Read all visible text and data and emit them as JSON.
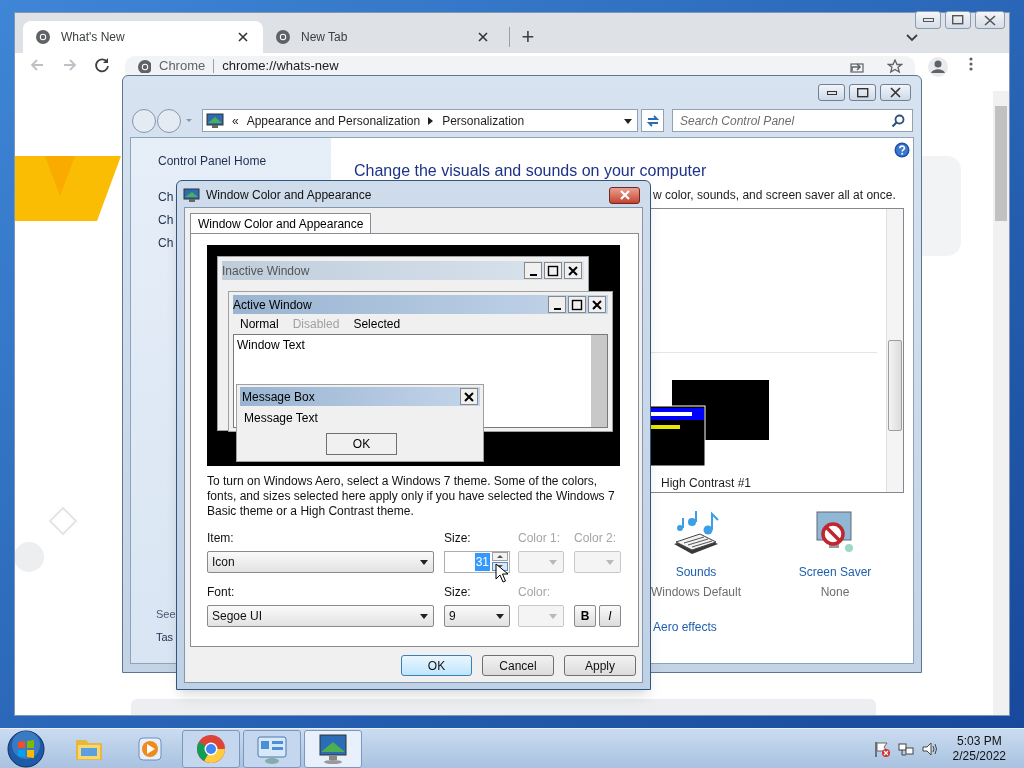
{
  "browser": {
    "tabs": [
      {
        "title": "What's New",
        "selected": true
      },
      {
        "title": "New Tab",
        "selected": false
      }
    ],
    "new_tab": "+",
    "address_bar": {
      "site": "Chrome",
      "url": "chrome://whats-new"
    }
  },
  "control_panel": {
    "breadcrumb_prefix": "«",
    "breadcrumb": [
      "Appearance and Personalization",
      "Personalization"
    ],
    "search": {
      "placeholder": "Search Control Panel"
    },
    "sidebar": {
      "items": [
        "Control Panel Home",
        "Ch",
        "Ch",
        "Ch"
      ],
      "see_also": [
        "See",
        "Tas"
      ]
    },
    "heading": "Change the visuals and sounds on your computer",
    "description": "w color, sounds, and screen saver all at once.",
    "themes": [
      {
        "name": "High Contrast #1"
      }
    ],
    "settings": [
      {
        "kind": "sounds",
        "label": "Sounds",
        "value": "Windows Default"
      },
      {
        "kind": "screen_saver",
        "label": "Screen Saver",
        "value": "None"
      }
    ],
    "link": "Aero effects"
  },
  "dialog": {
    "title": "Window Color and Appearance",
    "tabs": [
      {
        "label": "Window Color and Appearance",
        "selected": true
      }
    ],
    "preview": {
      "inactive_title": "Inactive Window",
      "active_title": "Active Window",
      "menu": [
        {
          "label": "Normal",
          "disabled": false
        },
        {
          "label": "Disabled",
          "disabled": true
        },
        {
          "label": "Selected",
          "disabled": false
        }
      ],
      "window_text": "Window Text",
      "message_title": "Message Box",
      "message_text": "Message Text",
      "ok": "OK"
    },
    "note": "To turn on Windows Aero, select a Windows 7 theme.  Some of the colors, fonts, and sizes selected here apply only if you have selected the Windows 7 Basic theme or a High Contrast theme.",
    "item": {
      "label": "Item:",
      "value": "Icon"
    },
    "size": {
      "label": "Size:",
      "value": "31",
      "highlighted": true
    },
    "color1": {
      "label": "Color 1:",
      "disabled": true
    },
    "color2": {
      "label": "Color 2:",
      "disabled": true
    },
    "font": {
      "label": "Font:",
      "value": "Segoe UI"
    },
    "font_size": {
      "label": "Size:",
      "value": "9"
    },
    "font_color": {
      "label": "Color:",
      "disabled": true
    },
    "bold": {
      "label": "B",
      "on": false
    },
    "italic": {
      "label": "I",
      "on": false
    },
    "buttons": [
      {
        "label": "OK",
        "default": true
      },
      {
        "label": "Cancel",
        "default": false
      },
      {
        "label": "Apply",
        "default": false
      }
    ]
  },
  "taskbar": {
    "apps": [
      {
        "kind": "folder",
        "open": false,
        "selected": false
      },
      {
        "kind": "media",
        "open": false,
        "selected": false
      },
      {
        "kind": "browser",
        "open": true,
        "selected": false
      },
      {
        "kind": "control_panel",
        "open": true,
        "selected": false
      },
      {
        "kind": "display",
        "open": true,
        "selected": true
      }
    ],
    "clock": {
      "time": "5:03 PM",
      "date": "2/25/2022"
    }
  }
}
